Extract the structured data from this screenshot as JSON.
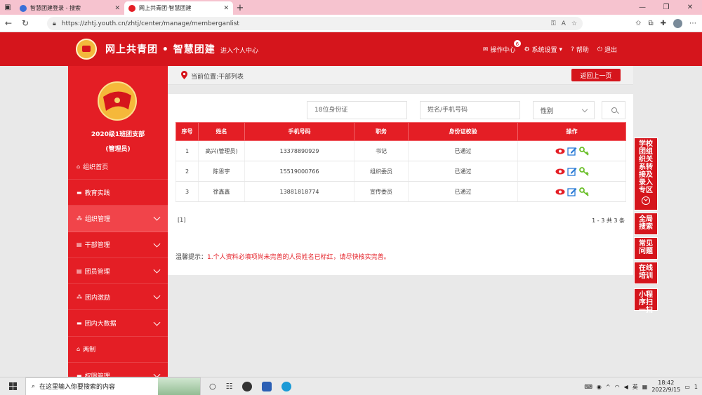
{
  "browser": {
    "tabs": [
      {
        "title": "智慧团建登录 - 搜索",
        "active": false
      },
      {
        "title": "网上共青团·智慧团建",
        "active": true
      }
    ],
    "url": "https://zhtj.youth.cn/zhtj/center/manage/memberganlist",
    "new_tab": "+"
  },
  "header": {
    "title": "网上共青团 • 智慧团建",
    "sub_link": "进入个人中心",
    "nav": [
      {
        "label": "操作中心",
        "icon": "mail-icon",
        "badge": "6"
      },
      {
        "label": "系统设置",
        "icon": "gear-icon"
      },
      {
        "label": "帮助",
        "icon": "help-icon"
      },
      {
        "label": "退出",
        "icon": "power-icon"
      }
    ]
  },
  "sidebar": {
    "org_name": "2020级1班团支部",
    "role": "(管理员)",
    "items": [
      {
        "label": "组织首页",
        "icon": "home-icon",
        "expandable": false
      },
      {
        "label": "教育实践",
        "icon": "folder-icon",
        "expandable": false
      },
      {
        "label": "组织管理",
        "icon": "org-icon",
        "expandable": true
      },
      {
        "label": "干部管理",
        "icon": "briefcase-icon",
        "expandable": true
      },
      {
        "label": "团员管理",
        "icon": "briefcase-icon",
        "expandable": true
      },
      {
        "label": "团内激励",
        "icon": "org-icon",
        "expandable": true
      },
      {
        "label": "团内大数据",
        "icon": "folder-icon",
        "expandable": true
      },
      {
        "label": "两制",
        "icon": "home-icon",
        "expandable": false
      },
      {
        "label": "权限管理",
        "icon": "folder-icon",
        "expandable": true
      }
    ]
  },
  "breadcrumb": {
    "label": "当前位置:干部列表",
    "back_button": "返回上一页"
  },
  "search": {
    "id_placeholder": "18位身份证",
    "name_placeholder": "姓名/手机号码",
    "gender_selected": "性别"
  },
  "table": {
    "headers": [
      "序号",
      "姓名",
      "手机号码",
      "职务",
      "身份证校验",
      "操作"
    ],
    "rows": [
      [
        "1",
        "高兴(管理员)",
        "13378890929",
        "书记",
        "已通过"
      ],
      [
        "2",
        "陈思宇",
        "15519000766",
        "组织委员",
        "已通过"
      ],
      [
        "3",
        "徐鑫鑫",
        "13881818774",
        "宣传委员",
        "已通过"
      ]
    ]
  },
  "pager": {
    "current": "[1]",
    "summary": "1 - 3  共 3 条"
  },
  "tip": {
    "prefix": "温馨提示：",
    "text": "1.个人资料必填项尚未完善的人员姓名已标红，请尽快核实完善。"
  },
  "float_menu": [
    {
      "label": "学校团组织关系转接及录入专区"
    },
    {
      "label": "全局搜索"
    },
    {
      "label": "常见问题"
    },
    {
      "label": "在线培训"
    },
    {
      "label": "小程序扫一扫"
    }
  ],
  "taskbar": {
    "search_placeholder": "在这里输入你要搜索的内容",
    "ime": "英",
    "time": "18:42",
    "date": "2022/9/15",
    "notif": "1"
  },
  "colors": {
    "brand_red": "#d5151c",
    "sidebar_red": "#e41e25"
  }
}
